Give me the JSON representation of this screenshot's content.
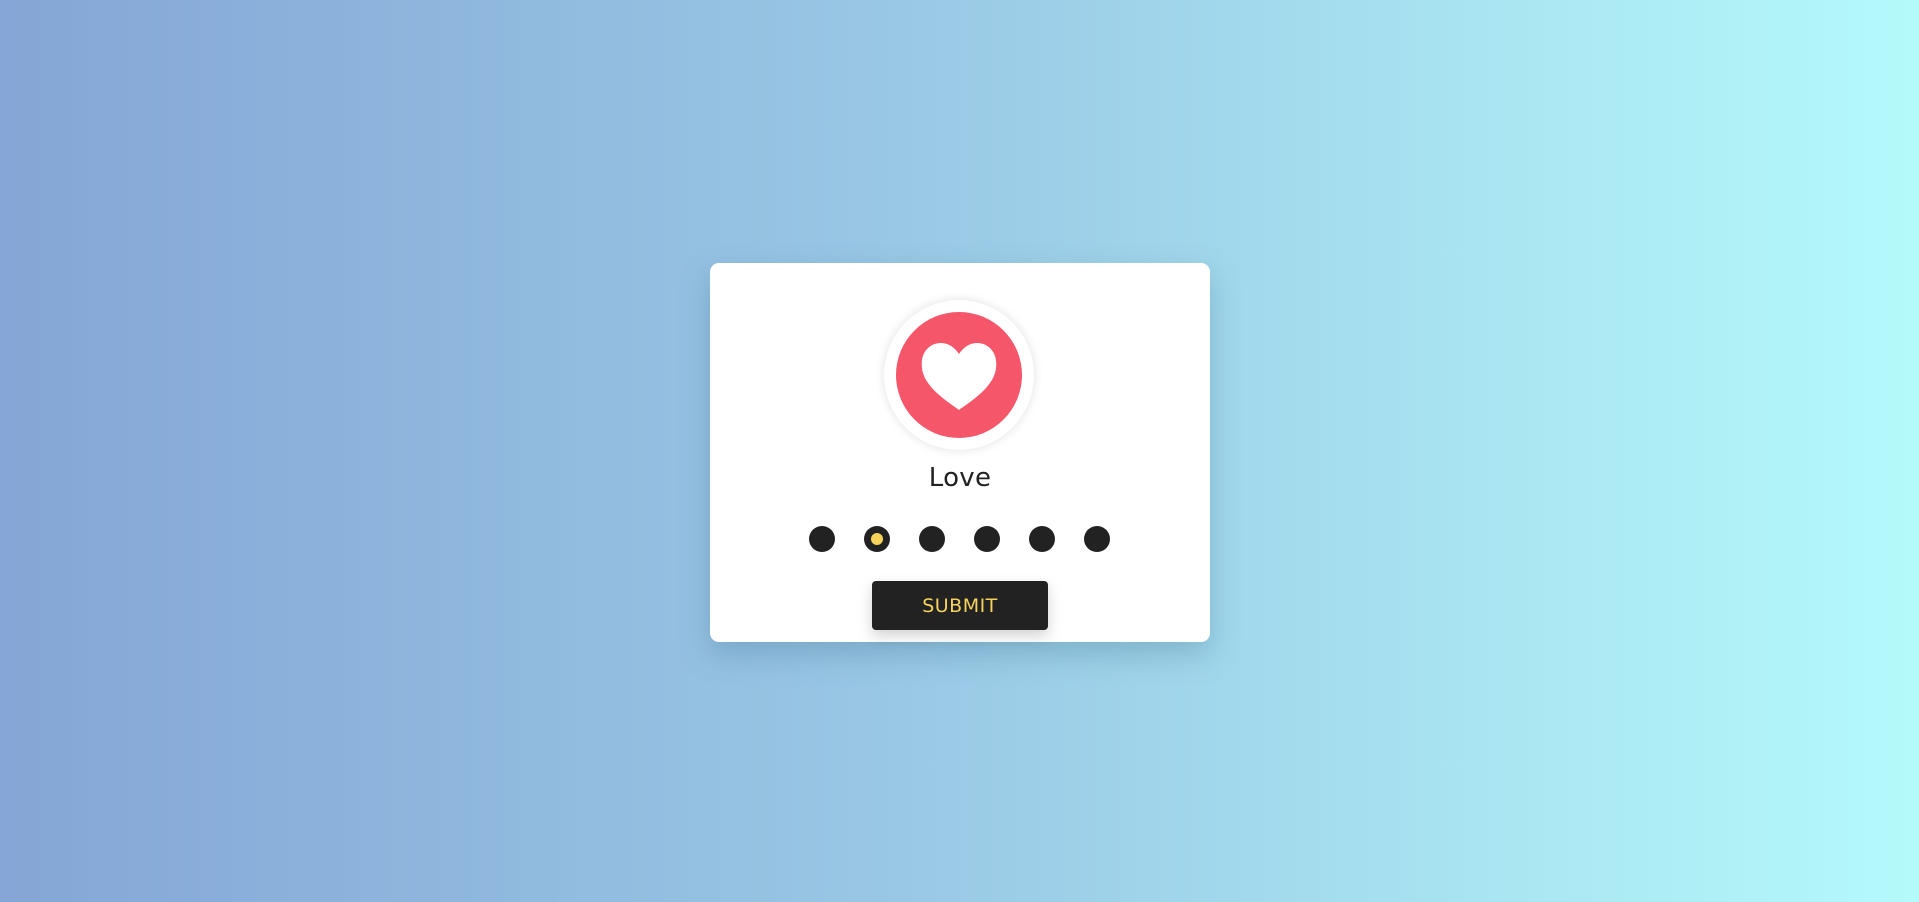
{
  "rating": {
    "label": "Love",
    "options_count": 6,
    "selected_index": 1,
    "icon": "heart-icon",
    "colors": {
      "emoji_background": "#f5566a",
      "dot": "#222222",
      "selected_dot_inner": "#f6d35b"
    }
  },
  "submit": {
    "label": "SUBMIT",
    "text_color": "#f6d35b",
    "background": "#222222"
  }
}
